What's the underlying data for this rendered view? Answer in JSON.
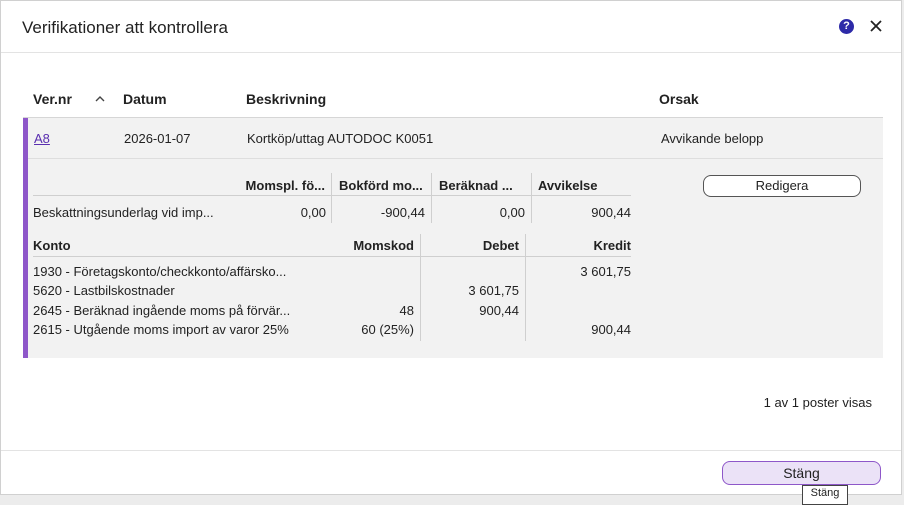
{
  "dialog": {
    "title": "Verifikationer att kontrollera",
    "help_icon": "?",
    "icons": [
      "question-circle-icon",
      "close-icon",
      "chevron-up-icon"
    ],
    "accent_color": "#8e57c9"
  },
  "table": {
    "headers": {
      "vernr": "Ver.nr",
      "datum": "Datum",
      "beskrivning": "Beskrivning",
      "orsak": "Orsak"
    },
    "sort_direction": "ascending",
    "row": {
      "vernr": "A8",
      "datum": "2026-01-07",
      "beskrivning": "Kortköp/uttag AUTODOC K0051",
      "orsak": "Avvikande belopp"
    }
  },
  "vat_table": {
    "headers": [
      "Momspl. fö...",
      "Bokförd mo...",
      "Beräknad ...",
      "Avvikelse"
    ],
    "row": {
      "label": "Beskattningsunderlag vid imp...",
      "values": [
        "0,00",
        "-900,44",
        "0,00",
        "900,44"
      ]
    }
  },
  "accounts_table": {
    "headers": {
      "konto": "Konto",
      "momskod": "Momskod",
      "debet": "Debet",
      "kredit": "Kredit"
    },
    "rows": [
      {
        "konto": "1930 - Företagskonto/checkkonto/affärsko...",
        "momskod": "",
        "debet": "",
        "kredit": "3 601,75"
      },
      {
        "konto": "5620 - Lastbilskostnader",
        "momskod": "",
        "debet": "3 601,75",
        "kredit": ""
      },
      {
        "konto": "2645 - Beräknad ingående moms på förvär...",
        "momskod": "48",
        "debet": "900,44",
        "kredit": ""
      },
      {
        "konto": "2615 - Utgående moms import av varor 25%",
        "momskod": "60 (25%)",
        "debet": "",
        "kredit": "900,44"
      }
    ]
  },
  "actions": {
    "edit_label": "Redigera",
    "close_label": "Stäng",
    "tooltip": "Stäng"
  },
  "pagination": {
    "text": "1 av 1 poster visas"
  }
}
